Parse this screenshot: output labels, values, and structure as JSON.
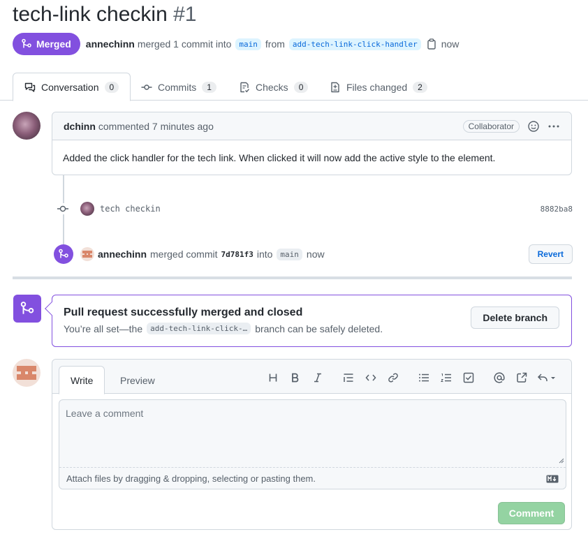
{
  "pr": {
    "title": "tech-link checkin",
    "number": "#1",
    "state": "Merged",
    "author": "annechinn",
    "merge_text": "merged 1 commit into",
    "base_branch": "main",
    "from_text": "from",
    "head_branch": "add-tech-link-click-handler",
    "time": "now"
  },
  "tabs": [
    {
      "label": "Conversation",
      "count": "0",
      "icon": "comment-discussion-icon"
    },
    {
      "label": "Commits",
      "count": "1",
      "icon": "git-commit-icon"
    },
    {
      "label": "Checks",
      "count": "0",
      "icon": "checklist-icon"
    },
    {
      "label": "Files changed",
      "count": "2",
      "icon": "file-diff-icon"
    }
  ],
  "comment": {
    "author": "dchinn",
    "action": "commented 7 minutes ago",
    "badge": "Collaborator",
    "body": "Added the click handler for the tech link. When clicked it will now add the active style to the element."
  },
  "commit": {
    "message": "tech checkin",
    "sha": "8882ba8"
  },
  "merge_event": {
    "user": "annechinn",
    "text": "merged commit",
    "sha": "7d781f3",
    "into": "into",
    "branch": "main",
    "time": "now",
    "revert_label": "Revert"
  },
  "merged_box": {
    "title": "Pull request successfully merged and closed",
    "sub_before": "You’re all set—the",
    "branch": "add-tech-link-click-…",
    "sub_after": "branch can be safely deleted.",
    "delete_label": "Delete branch"
  },
  "new_comment": {
    "write_tab": "Write",
    "preview_tab": "Preview",
    "placeholder": "Leave a comment",
    "attach_text": "Attach files by dragging & dropping, selecting or pasting them.",
    "submit_label": "Comment"
  },
  "colors": {
    "merged": "#8250df",
    "link": "#0969da",
    "submit_disabled": "#94d3a2"
  }
}
